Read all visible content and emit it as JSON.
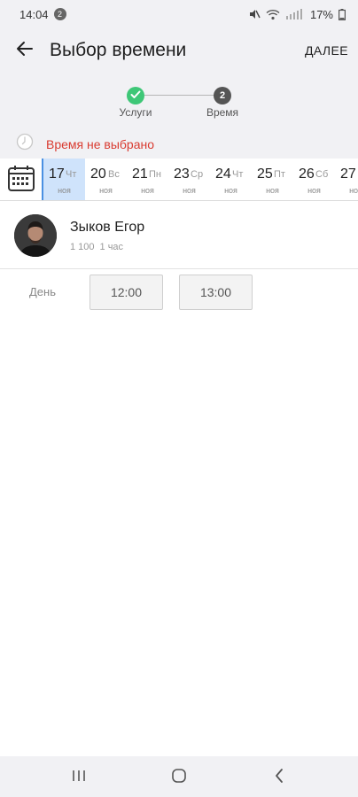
{
  "status_bar": {
    "time": "14:04",
    "notification_count": "2",
    "battery": "17%",
    "icons": [
      "mute-icon",
      "wifi-icon",
      "signal-icon",
      "battery-icon"
    ]
  },
  "header": {
    "back_icon": "arrow-left-icon",
    "title": "Выбор времени",
    "next_label": "ДАЛЕЕ"
  },
  "stepper": {
    "steps": [
      {
        "label": "Услуги",
        "state": "done",
        "icon": "check-icon"
      },
      {
        "label": "Время",
        "state": "current",
        "number": "2"
      }
    ],
    "colors": {
      "done": "#3ec777",
      "current": "#555555"
    }
  },
  "warning": {
    "icon": "clock-icon",
    "text": "Время не выбрано",
    "color": "#d93b30"
  },
  "date_strip": {
    "calendar_icon": "calendar-icon",
    "days": [
      {
        "day": "17",
        "weekday": "Чт",
        "month": "ноя",
        "selected": true
      },
      {
        "day": "20",
        "weekday": "Вс",
        "month": "ноя",
        "selected": false
      },
      {
        "day": "21",
        "weekday": "Пн",
        "month": "ноя",
        "selected": false
      },
      {
        "day": "23",
        "weekday": "Ср",
        "month": "ноя",
        "selected": false
      },
      {
        "day": "24",
        "weekday": "Чт",
        "month": "ноя",
        "selected": false
      },
      {
        "day": "25",
        "weekday": "Пт",
        "month": "ноя",
        "selected": false
      },
      {
        "day": "26",
        "weekday": "Сб",
        "month": "ноя",
        "selected": false
      },
      {
        "day": "27",
        "weekday": "",
        "month": "ноя",
        "selected": false
      }
    ],
    "selected_color": "#cfe3fb",
    "accent_color": "#4a90e2"
  },
  "master": {
    "name": "Зыков Егор",
    "price": "1 100",
    "duration": "1 час"
  },
  "slots": {
    "period_label": "День",
    "times": [
      "12:00",
      "13:00"
    ]
  },
  "nav_bar": {
    "icons": [
      "recents-icon",
      "home-icon",
      "back-icon"
    ]
  }
}
